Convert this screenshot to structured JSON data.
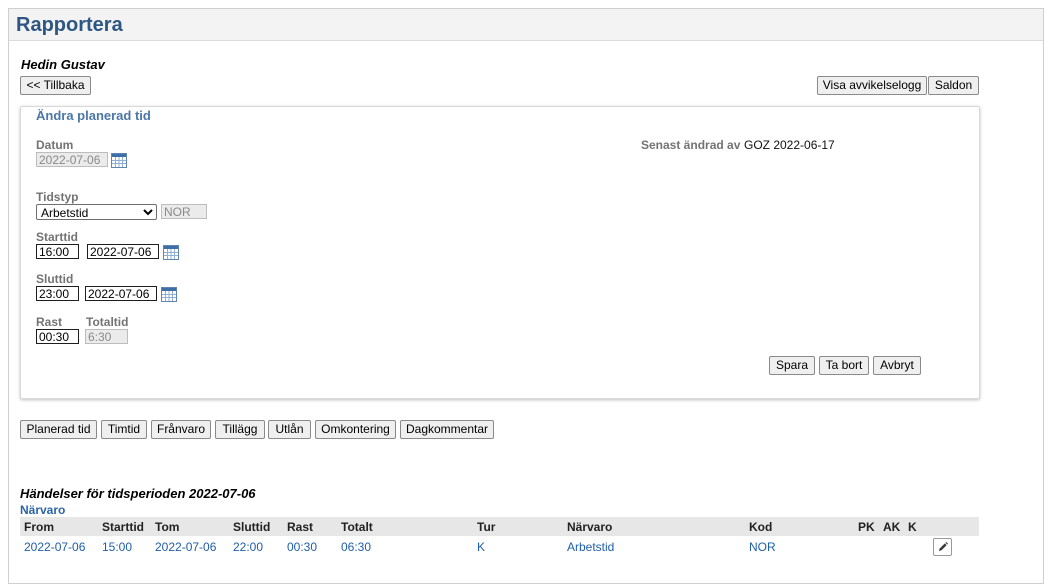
{
  "page": {
    "title": "Rapportera"
  },
  "person": {
    "name": "Hedin Gustav"
  },
  "toolbar": {
    "back_label": "<< Tillbaka",
    "deviation_log_label": "Visa avvikelselogg",
    "balances_label": "Saldon"
  },
  "form": {
    "title": "Ändra planerad tid",
    "date": {
      "label": "Datum",
      "value": "2022-07-06"
    },
    "last_changed": {
      "label": "Senast ändrad av",
      "value": "GOZ 2022-06-17"
    },
    "time_type": {
      "label": "Tidstyp",
      "selected": "Arbetstid",
      "code": "NOR"
    },
    "start": {
      "label": "Starttid",
      "time": "16:00",
      "date": "2022-07-06"
    },
    "end": {
      "label": "Sluttid",
      "time": "23:00",
      "date": "2022-07-06"
    },
    "break": {
      "label": "Rast",
      "value": "00:30"
    },
    "total": {
      "label": "Totaltid",
      "value": "6:30"
    },
    "buttons": {
      "save": "Spara",
      "delete": "Ta bort",
      "cancel": "Avbryt"
    }
  },
  "tabs": [
    "Planerad tid",
    "Timtid",
    "Frånvaro",
    "Tillägg",
    "Utlån",
    "Omkontering",
    "Dagkommentar"
  ],
  "events": {
    "heading": "Händelser för tidsperioden 2022-07-06",
    "section": "Närvaro",
    "columns": [
      "From",
      "Starttid",
      "Tom",
      "Sluttid",
      "Rast",
      "Totalt",
      "Tur",
      "Närvaro",
      "Kod",
      "PK",
      "AK",
      "K"
    ],
    "rows": [
      {
        "from": "2022-07-06",
        "start": "15:00",
        "to": "2022-07-06",
        "end": "22:00",
        "break": "00:30",
        "total": "06:30",
        "shift": "K",
        "attendance": "Arbetstid",
        "code": "NOR",
        "pk": "",
        "ak": "",
        "k": ""
      }
    ]
  },
  "icons": {
    "date_picker": "calendar-icon",
    "edit_row": "pencil-icon"
  },
  "colors": {
    "title": "#2d5683",
    "panel_title": "#4b77a8",
    "link": "#1f5ea8",
    "header_bg": "#f3f3f3",
    "table_header_bg": "#e7e7e7"
  }
}
